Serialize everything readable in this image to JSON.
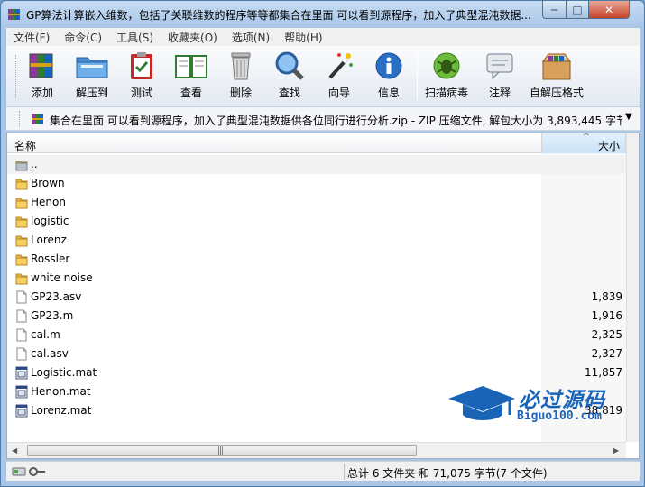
{
  "window": {
    "title": "GP算法计算嵌入维数，包括了关联维数的程序等等都集合在里面 可以看到源程序，加入了典型混沌数据...",
    "min_symbol": "─",
    "max_symbol": "□",
    "close_symbol": "✕"
  },
  "menu": [
    "文件(F)",
    "命令(C)",
    "工具(S)",
    "收藏夹(O)",
    "选项(N)",
    "帮助(H)"
  ],
  "toolbar": {
    "add": "添加",
    "extract": "解压到",
    "test": "测试",
    "view": "查看",
    "delete": "删除",
    "find": "查找",
    "wizard": "向导",
    "info": "信息",
    "scan": "扫描病毒",
    "comment": "注释",
    "sfx": "自解压格式"
  },
  "address": {
    "text": "集合在里面 可以看到源程序，加入了典型混沌数据供各位同行进行分析.zip - ZIP 压缩文件, 解包大小为 3,893,445 字节",
    "dropdown": "▼"
  },
  "columns": {
    "name": "名称",
    "size": "大小",
    "sort": "^"
  },
  "files": [
    {
      "name": "..",
      "size": "",
      "type": "up"
    },
    {
      "name": "Brown",
      "size": "",
      "type": "folder"
    },
    {
      "name": "Henon",
      "size": "",
      "type": "folder"
    },
    {
      "name": "logistic",
      "size": "",
      "type": "folder"
    },
    {
      "name": "Lorenz",
      "size": "",
      "type": "folder"
    },
    {
      "name": "Rossler",
      "size": "",
      "type": "folder"
    },
    {
      "name": "white noise",
      "size": "",
      "type": "folder"
    },
    {
      "name": "GP23.asv",
      "size": "1,839",
      "type": "file"
    },
    {
      "name": "GP23.m",
      "size": "1,916",
      "type": "file"
    },
    {
      "name": "cal.m",
      "size": "2,325",
      "type": "file"
    },
    {
      "name": "cal.asv",
      "size": "2,327",
      "type": "file"
    },
    {
      "name": "Logistic.mat",
      "size": "11,857",
      "type": "mat"
    },
    {
      "name": "Henon.mat",
      "size": "",
      "type": "mat"
    },
    {
      "name": "Lorenz.mat",
      "size": "38,819",
      "type": "mat"
    }
  ],
  "status": {
    "text": "总计 6 文件夹 和 71,075 字节(7 个文件)"
  },
  "watermark": {
    "text": "必过源码",
    "sub": "Biguo100.com"
  },
  "scroll": {
    "thumb_grip": "|||"
  }
}
